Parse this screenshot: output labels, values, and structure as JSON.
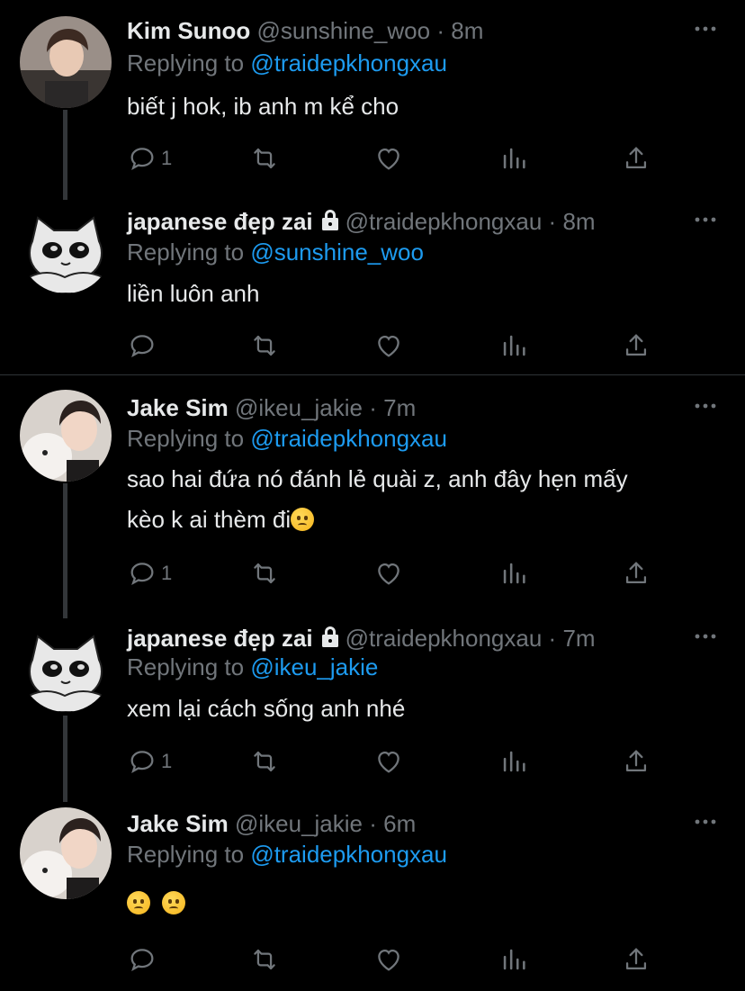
{
  "tweets": [
    {
      "name": "Kim Sunoo",
      "handle": "@sunshine_woo",
      "sep": "·",
      "time": "8m",
      "locked": false,
      "replying_label": "Replying to",
      "replying_to": "@traidepkhongxau",
      "text": "biết j hok, ib anh m kể cho",
      "reply_count": "1",
      "avatar": "person-avatar"
    },
    {
      "name": "japanese đẹp zai",
      "handle": "@traidepkhongxau",
      "sep": "·",
      "time": "8m",
      "locked": true,
      "replying_label": "Replying to",
      "replying_to": "@sunshine_woo",
      "text": "liền luôn anh",
      "reply_count": "",
      "avatar": "cat-avatar"
    },
    {
      "name": "Jake Sim",
      "handle": "@ikeu_jakie",
      "sep": "·",
      "time": "7m",
      "locked": false,
      "replying_label": "Replying to",
      "replying_to": "@traidepkhongxau",
      "text_line1": "sao hai đứa nó đánh lẻ quài z, anh đây hẹn mấy",
      "text_line2": "kèo k ai thèm đi",
      "text_emoji": "confused-face-emoji",
      "reply_count": "1",
      "avatar": "person-dog-avatar"
    },
    {
      "name": "japanese đẹp zai",
      "handle": "@traidepkhongxau",
      "sep": "·",
      "time": "7m",
      "locked": true,
      "replying_label": "Replying to",
      "replying_to": "@ikeu_jakie",
      "text": "xem lại cách sống anh nhé",
      "reply_count": "1",
      "avatar": "cat-avatar"
    },
    {
      "name": "Jake Sim",
      "handle": "@ikeu_jakie",
      "sep": "·",
      "time": "6m",
      "locked": false,
      "replying_label": "Replying to",
      "replying_to": "@traidepkhongxau",
      "text_emojis": [
        "frowning-face-emoji",
        "frowning-face-emoji"
      ],
      "reply_count": "",
      "avatar": "person-dog-avatar"
    }
  ],
  "colors": {
    "background": "#000000",
    "text": "#e7e9ea",
    "muted": "#71767b",
    "accent": "#1d9bf0",
    "line": "#333639"
  }
}
